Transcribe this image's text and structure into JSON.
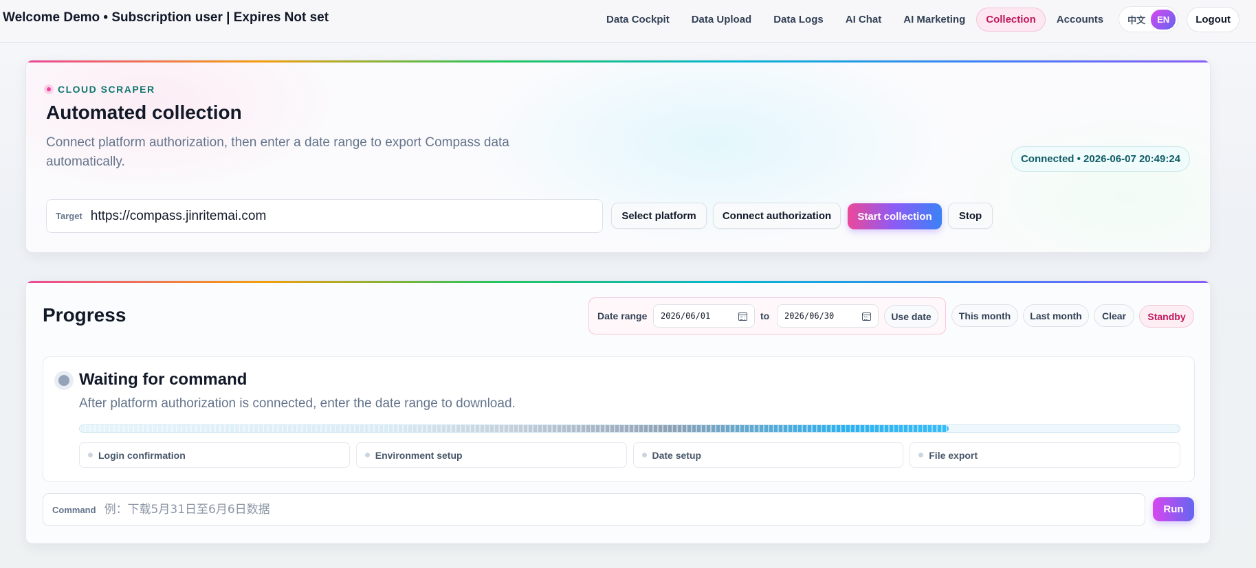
{
  "header": {
    "welcome": "Welcome Demo • Subscription user | Expires Not set",
    "nav": [
      {
        "label": "Data Cockpit"
      },
      {
        "label": "Data Upload"
      },
      {
        "label": "Data Logs"
      },
      {
        "label": "AI Chat"
      },
      {
        "label": "AI Marketing"
      },
      {
        "label": "Collection",
        "active": true
      },
      {
        "label": "Accounts"
      }
    ],
    "lang_zh": "中文",
    "lang_en": "EN",
    "logout": "Logout"
  },
  "scraper": {
    "eyebrow": "CLOUD SCRAPER",
    "title": "Automated collection",
    "description": "Connect platform authorization, then enter a date range to export Compass data automatically.",
    "status": "Connected • 2026-06-07 20:49:24",
    "target_label": "Target",
    "target_value": "https://compass.jinritemai.com",
    "buttons": {
      "select_platform": "Select platform",
      "connect_authorization": "Connect authorization",
      "start_collection": "Start collection",
      "stop": "Stop"
    }
  },
  "progress": {
    "title": "Progress",
    "date_range_label": "Date range",
    "date_from": "2026/06/01",
    "date_to_label": "to",
    "date_to": "2026/06/30",
    "use_date": "Use date",
    "this_month": "This month",
    "last_month": "Last month",
    "clear": "Clear",
    "status": "Standby",
    "state_title": "Waiting for command",
    "state_description": "After platform authorization is connected, enter the date range to download.",
    "progress_fraction": 0.79,
    "steps": [
      "Login confirmation",
      "Environment setup",
      "Date setup",
      "File export"
    ],
    "command_label": "Command",
    "command_placeholder": "例：下载5月31日至6月6日数据",
    "run": "Run"
  },
  "colors": {
    "accent_pink": "#ec4899",
    "accent_purple": "#8b5cf6",
    "accent_blue": "#3b82f6",
    "status_teal": "#0f5c66"
  }
}
